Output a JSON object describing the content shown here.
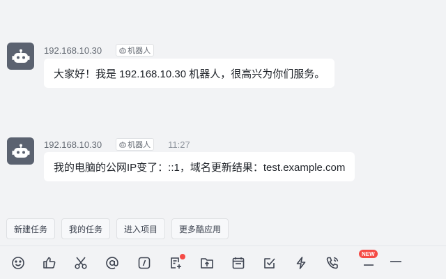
{
  "messages": [
    {
      "sender": "192.168.10.30",
      "badge": "机器人",
      "time": "",
      "text": "大家好！我是 192.168.10.30 机器人，很高兴为你们服务。"
    },
    {
      "sender": "192.168.10.30",
      "badge": "机器人",
      "time": "11:27",
      "text": "我的电脑的公网IP变了：::1，域名更新结果：test.example.com"
    }
  ],
  "quick_actions": [
    "新建任务",
    "我的任务",
    "进入项目",
    "更多酷应用"
  ],
  "toolbar": {
    "icons": [
      "emoji-icon",
      "thumbs-up-icon",
      "scissors-icon",
      "at-icon",
      "slash-command-icon",
      "doc-add-icon",
      "upload-folder-icon",
      "calendar-icon",
      "task-check-icon",
      "lightning-icon",
      "phone-call-icon",
      "new-feature-icon",
      "more-icon"
    ],
    "new_label": "NEW"
  },
  "colors": {
    "badge_red": "#f54a45",
    "avatar": "#5b6270",
    "bg": "#f2f3f5"
  }
}
